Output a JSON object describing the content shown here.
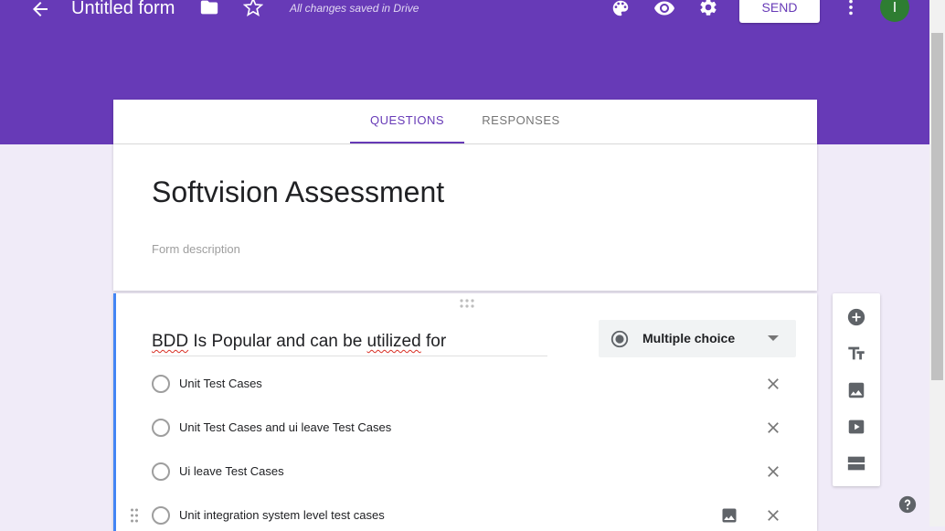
{
  "header": {
    "form_title": "Untitled form",
    "save_status": "All changes saved in Drive",
    "send_label": "SEND",
    "avatar_initial": "I",
    "background_color": "#673ab7"
  },
  "tabs": [
    {
      "label": "QUESTIONS",
      "active": true
    },
    {
      "label": "RESPONSES",
      "active": false
    }
  ],
  "form": {
    "title": "Softvision Assessment",
    "description_placeholder": "Form description"
  },
  "question": {
    "text_part1": "BDD",
    "text_part2": " Is Popular and can be ",
    "text_part3": "utilized",
    "text_part4": " for",
    "type": "Multiple choice",
    "options": [
      {
        "label": "Unit Test Cases"
      },
      {
        "label": "Unit Test Cases and ui leave Test Cases"
      },
      {
        "label": "Ui leave Test Cases"
      },
      {
        "label": "Unit integration system level test cases"
      }
    ]
  },
  "toolbar_icons": [
    "add-question-icon",
    "add-title-icon",
    "add-image-icon",
    "add-video-icon",
    "add-section-icon"
  ],
  "colors": {
    "accent": "#673ab7",
    "question_border": "#4285f4",
    "background": "#f0ebf8"
  }
}
